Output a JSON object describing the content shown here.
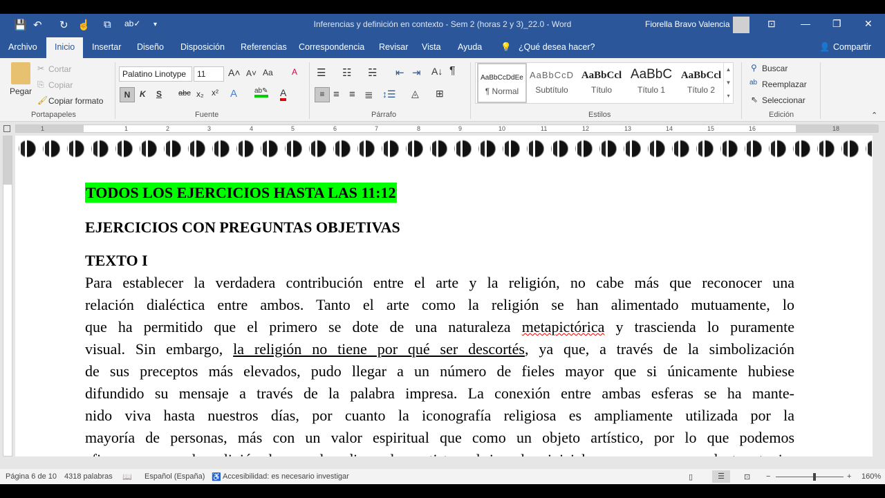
{
  "titlebar": {
    "title": "Inferencias y definición en contexto - Sem 2 (horas 2 y 3)_22.0  -  Word",
    "user": "Fiorella Bravo Valencia"
  },
  "tabs": [
    "Archivo",
    "Inicio",
    "Insertar",
    "Diseño",
    "Disposición",
    "Referencias",
    "Correspondencia",
    "Revisar",
    "Vista",
    "Ayuda"
  ],
  "tell_me": "¿Qué desea hacer?",
  "share": "Compartir",
  "clipboard": {
    "paste": "Pegar",
    "cut": "Cortar",
    "copy": "Copiar",
    "format_painter": "Copiar formato",
    "group": "Portapapeles"
  },
  "font": {
    "name": "Palatino Linotype",
    "size": "11",
    "bold": "N",
    "italic": "K",
    "underline": "S",
    "strike": "abc",
    "change_case": "Aa",
    "group": "Fuente"
  },
  "paragraph": {
    "group": "Párrafo"
  },
  "styles": {
    "items": [
      {
        "preview": "AaBbCcDdEe",
        "label": "¶ Normal"
      },
      {
        "preview": "AaBbCcD",
        "label": "Subtítulo"
      },
      {
        "preview": "AaBbCcl",
        "label": "Título"
      },
      {
        "preview": "AaBbC",
        "label": "Título 1"
      },
      {
        "preview": "AaBbCcl",
        "label": "Título 2"
      }
    ],
    "group": "Estilos"
  },
  "editing": {
    "find": "Buscar",
    "replace": "Reemplazar",
    "select": "Seleccionar",
    "group": "Edición"
  },
  "ruler": [
    "1",
    "1",
    "2",
    "3",
    "4",
    "5",
    "6",
    "7",
    "8",
    "9",
    "10",
    "11",
    "12",
    "13",
    "14",
    "15",
    "16",
    "18"
  ],
  "document": {
    "highlight": "TODOS LOS EJERCICIOS HASTA LAS 11:12",
    "heading1": "EJERCICIOS CON PREGUNTAS OBJETIVAS",
    "heading2": "TEXTO I",
    "lines": [
      "Para establecer la verdadera contribución entre el arte y la religión, no cabe más que reconocer una",
      "relación dialéctica entre ambos. Tanto el arte como la religión se han alimentado mutuamente, lo",
      {
        "a": "que ha permitido que el primero se dote de una naturaleza ",
        "b": "metapictórica",
        "c": " y trascienda lo puramente"
      },
      {
        "a": "visual. Sin embargo, ",
        "b": "la religión no tiene por qué ser descortés",
        "c": ", ya que, a través de la simbolización"
      },
      "de sus preceptos más elevados, pudo llegar a un número de fieles mayor que si únicamente hubiese",
      "difundido su mensaje a través de la palabra impresa. La conexión entre ambas esferas se ha mante-",
      "nido viva hasta nuestros días, por cuanto la iconografía religiosa es ampliamente utilizada por la",
      "mayoría de personas, más con un valor espiritual que como un objeto artístico, por lo que podemos",
      "afirmar que es la religión la que les dio a los artistas el impulso inicial para que sus productos tuvie-"
    ]
  },
  "status": {
    "page": "Página 6 de 10",
    "words": "4318 palabras",
    "language": "Español (España)",
    "accessibility": "Accesibilidad: es necesario investigar",
    "zoom": "160%"
  }
}
